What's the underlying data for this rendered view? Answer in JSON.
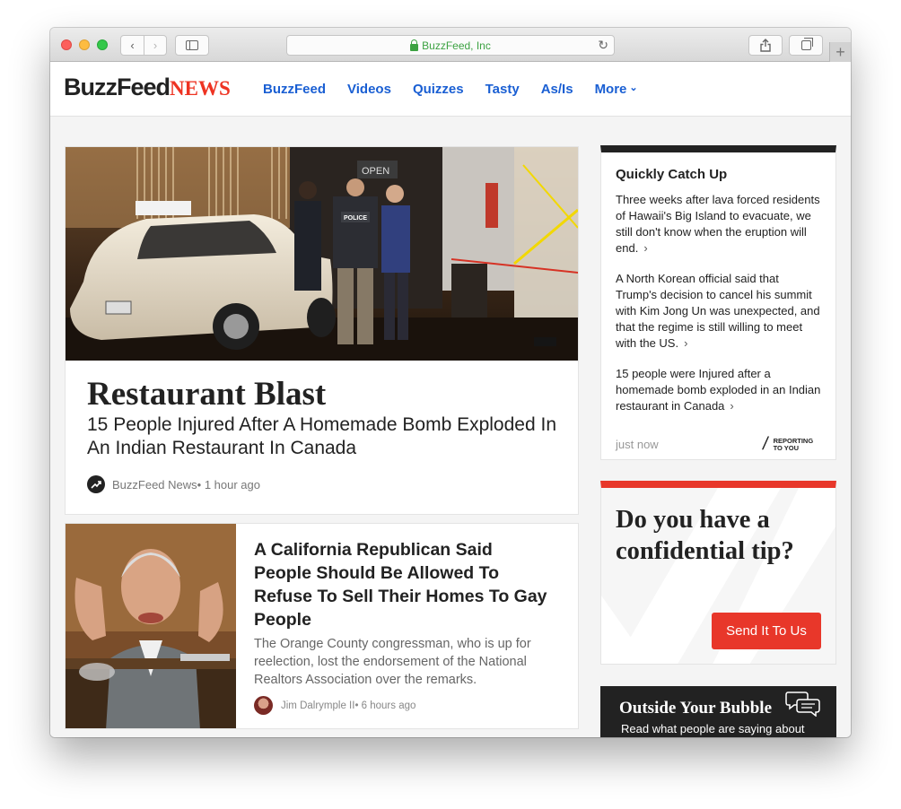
{
  "browser": {
    "url_text": "BuzzFeed, Inc",
    "back_glyph": "‹",
    "forward_glyph": "›",
    "reload_glyph": "↻",
    "new_tab_glyph": "+",
    "colors": {
      "secure": "#3ca242"
    }
  },
  "site": {
    "logo_main": "BuzzFeed",
    "logo_sub": "NEWS",
    "nav": [
      "BuzzFeed",
      "Videos",
      "Quizzes",
      "Tasty",
      "As/Is",
      "More"
    ]
  },
  "feature": {
    "title": "Restaurant Blast",
    "subtitle": "15 People Injured After A Homemade Bomb Exploded In An Indian Restaurant In Canada",
    "source": "BuzzFeed News",
    "time": " • 1 hour ago",
    "image_labels": {
      "police": "POLICE",
      "open": "OPEN"
    }
  },
  "story": {
    "title": "A California Republican Said People Should Be Allowed To Refuse To Sell Their Homes To Gay People",
    "description": "The Orange County congressman, who is up for reelection, lost the endorsement of the National Realtors Association over the remarks.",
    "author": "Jim Dalrymple II",
    "time": " • 6 hours ago"
  },
  "catchup": {
    "heading": "Quickly Catch Up",
    "items": [
      "Three weeks after lava forced residents of Hawaii's Big Island to evacuate, we still don't know when the eruption will end.",
      "A North Korean official said that Trump's decision to cancel his summit with Kim Jong Un was unexpected, and that the regime is still willing to meet with the US.",
      "15 people were Injured after a homemade bomb exploded in an Indian restaurant in Canada"
    ],
    "chevron": "›",
    "timestamp": "just now",
    "reporting_line1": "REPORTING",
    "reporting_line2": "TO YOU"
  },
  "tip": {
    "title": "Do you have a confidential tip?",
    "button": "Send It To Us",
    "accent": "#e8372a"
  },
  "bubble": {
    "title": "Outside Your Bubble",
    "subtitle": "Read what people are saying about"
  },
  "icons": [
    "lock-icon",
    "reload-icon",
    "sidebar-icon",
    "share-icon",
    "tabs-icon",
    "trending-icon",
    "chat-bubbles-icon"
  ]
}
